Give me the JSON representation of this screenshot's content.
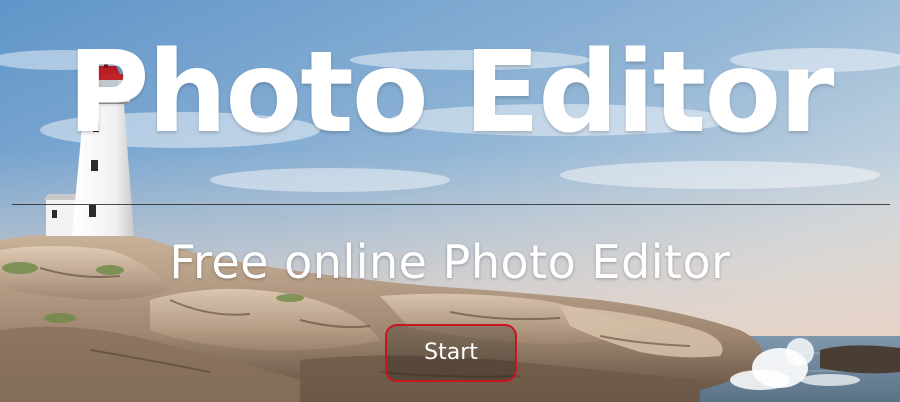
{
  "hero": {
    "title": "Photo Editor",
    "subtitle": "Free online Photo Editor",
    "start_button_label": "Start"
  },
  "colors": {
    "title_text": "#ffffff",
    "button_border": "#c8161d",
    "divider": "#2c2c2c"
  },
  "icons": {
    "background": "lighthouse-coast-photo"
  }
}
